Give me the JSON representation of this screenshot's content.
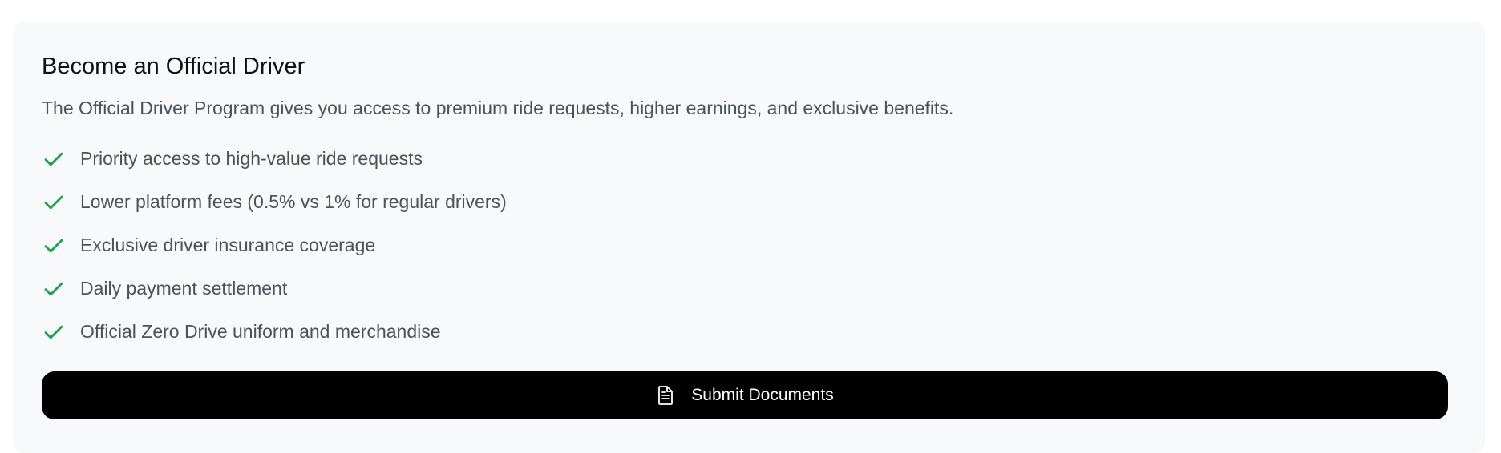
{
  "program": {
    "title": "Become an Official Driver",
    "description": "The Official Driver Program gives you access to premium ride requests, higher earnings, and exclusive benefits.",
    "benefits": [
      "Priority access to high-value ride requests",
      "Lower platform fees (0.5% vs 1% for regular drivers)",
      "Exclusive driver insurance coverage",
      "Daily payment settlement",
      "Official Zero Drive uniform and merchandise"
    ],
    "submit_label": "Submit Documents"
  },
  "colors": {
    "card_background": "#f8f9fa",
    "check": "#16a34a",
    "button_background": "#000000",
    "button_text": "#ffffff"
  },
  "icons": {
    "benefit": "check-icon",
    "submit": "document-icon"
  }
}
